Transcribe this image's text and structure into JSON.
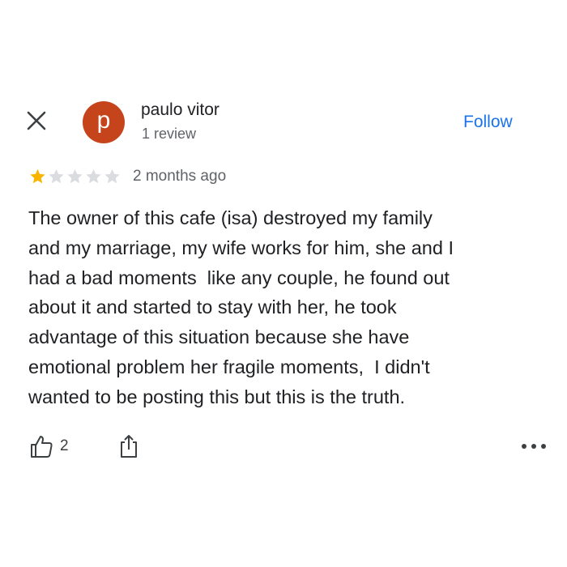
{
  "author": {
    "name": "paulo vitor",
    "initial": "p",
    "review_count": "1 review",
    "avatar_color": "#c5441c"
  },
  "header": {
    "close_icon": "close-icon",
    "follow_label": "Follow",
    "accent_color": "#1a73e8"
  },
  "rating": {
    "value": 1,
    "max": 5,
    "filled_color": "#f9b400",
    "empty_color": "#dadce0",
    "time_ago": "2 months ago"
  },
  "review": {
    "lines": [
      "The owner of this cafe (isa) destroyed my family",
      "and my marriage, my wife works for him, she and I",
      "had a bad moments  like any couple, he found out",
      "about it and started to stay with her, he took",
      "advantage of this situation because she have",
      "emotional problem her fragile moments,  I didn't",
      "wanted to be posting this but this is the truth."
    ]
  },
  "actions": {
    "like_icon": "thumbs-up-icon",
    "like_count": "2",
    "share_icon": "share-icon",
    "more_icon": "more-options-icon"
  }
}
